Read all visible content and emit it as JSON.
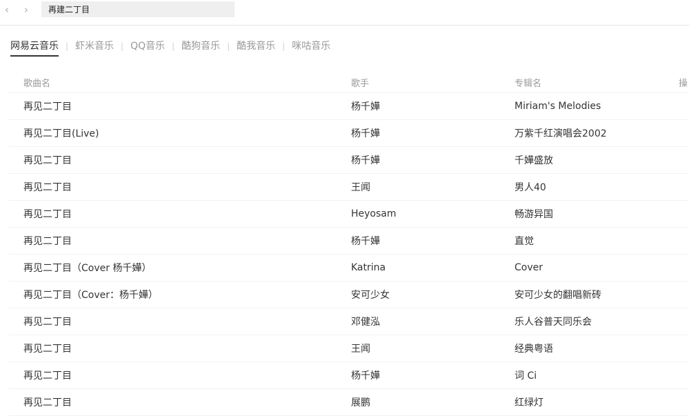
{
  "nav": {
    "back_icon": "‹",
    "forward_icon": "›"
  },
  "search": {
    "value": "再建二丁目"
  },
  "sources": [
    "网易云音乐",
    "虾米音乐",
    "QQ音乐",
    "酷狗音乐",
    "酷我音乐",
    "咪咕音乐"
  ],
  "active_source": 0,
  "table": {
    "headers": {
      "title": "歌曲名",
      "artist": "歌手",
      "album": "专辑名",
      "op": "操"
    },
    "rows": [
      {
        "title": "再见二丁目",
        "artist": "杨千嬅",
        "album": "Miriam's Melodies"
      },
      {
        "title": "再见二丁目(Live)",
        "artist": "杨千嬅",
        "album": "万紫千红演唱会2002"
      },
      {
        "title": "再见二丁目",
        "artist": "杨千嬅",
        "album": "千嬅盛放"
      },
      {
        "title": "再见二丁目",
        "artist": "王闻",
        "album": "男人40"
      },
      {
        "title": "再见二丁目",
        "artist": "Heyosam",
        "album": "畅游异国"
      },
      {
        "title": "再见二丁目",
        "artist": "杨千嬅",
        "album": "直觉"
      },
      {
        "title": "再见二丁目（Cover 杨千嬅）",
        "artist": "Katrina",
        "album": "Cover"
      },
      {
        "title": "再见二丁目（Cover：杨千嬅）",
        "artist": "安可少女",
        "album": "安可少女的翻唱新砖"
      },
      {
        "title": "再见二丁目",
        "artist": "邓健泓",
        "album": "乐人谷普天同乐会"
      },
      {
        "title": "再见二丁目",
        "artist": "王闻",
        "album": "经典粤语"
      },
      {
        "title": "再见二丁目",
        "artist": "杨千嬅",
        "album": "词 Ci"
      },
      {
        "title": "再见二丁目",
        "artist": "展鹏",
        "album": "红绿灯"
      }
    ]
  }
}
